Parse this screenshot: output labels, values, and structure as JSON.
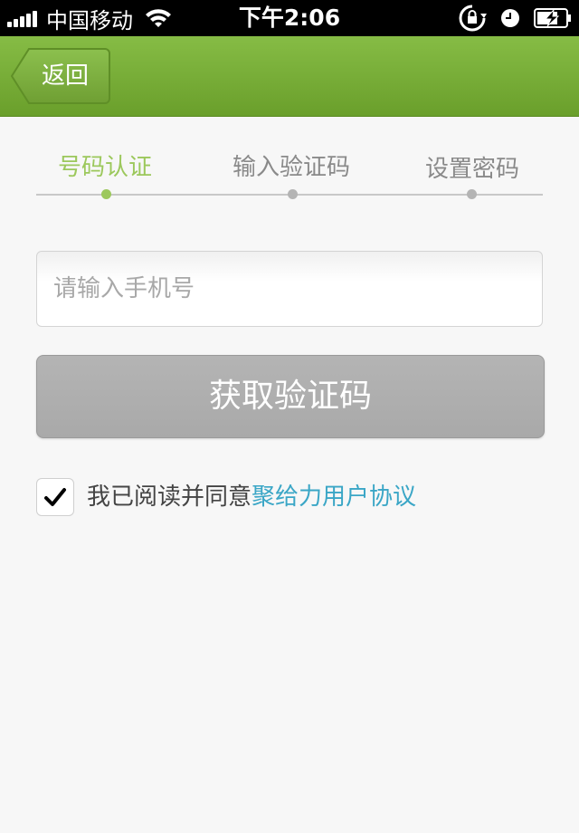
{
  "status_bar": {
    "carrier": "中国移动",
    "time": "下午2:06",
    "icons": [
      "signal-icon",
      "wifi-icon",
      "rotation-lock-icon",
      "alarm-clock-icon",
      "battery-charging-icon"
    ]
  },
  "nav": {
    "back_label": "返回",
    "colors": {
      "bar_top": "#86bc45",
      "bar_bottom": "#6a9f2b"
    }
  },
  "steps": {
    "items": [
      {
        "label": "号码认证",
        "active": true
      },
      {
        "label": "输入验证码",
        "active": false
      },
      {
        "label": "设置密码",
        "active": false
      }
    ],
    "active_color": "#9cc85c"
  },
  "form": {
    "phone_placeholder": "请输入手机号",
    "phone_value": "",
    "get_code_label": "获取验证码"
  },
  "agreement": {
    "checked": true,
    "text": "我已阅读并同意",
    "link_text": "聚给力用户协议",
    "link_color": "#3aa6c6"
  }
}
